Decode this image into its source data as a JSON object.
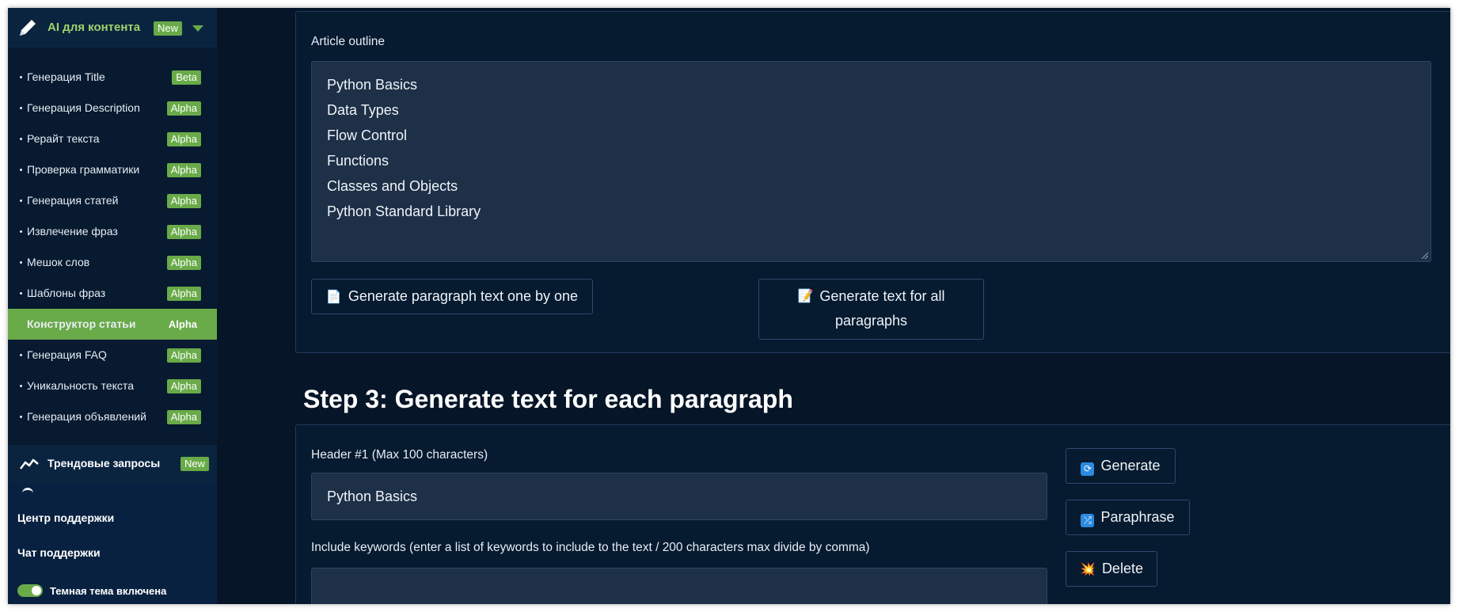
{
  "sidebar": {
    "header": {
      "title": "AI для контента",
      "badge": "New"
    },
    "items": [
      {
        "label": "Генерация Title",
        "badge": "Beta"
      },
      {
        "label": "Генерация Description",
        "badge": "Alpha"
      },
      {
        "label": "Рерайт текста",
        "badge": "Alpha"
      },
      {
        "label": "Проверка грамматики",
        "badge": "Alpha"
      },
      {
        "label": "Генерация статей",
        "badge": "Alpha"
      },
      {
        "label": "Извлечение фраз",
        "badge": "Alpha"
      },
      {
        "label": "Мешок слов",
        "badge": "Alpha"
      },
      {
        "label": "Шаблоны фраз",
        "badge": "Alpha"
      },
      {
        "label": "Конструктор статьи",
        "badge": "Alpha",
        "active": true
      },
      {
        "label": "Генерация FAQ",
        "badge": "Alpha"
      },
      {
        "label": "Уникальность текста",
        "badge": "Alpha"
      },
      {
        "label": "Генерация объявлений",
        "badge": "Alpha"
      }
    ],
    "trend": {
      "title": "Трендовые запросы",
      "badge": "New"
    },
    "support_center": "Центр поддержки",
    "support_chat": "Чат поддержки",
    "dark_theme": {
      "label": "Темная тема включена",
      "enabled": true
    }
  },
  "outline": {
    "label": "Article outline",
    "lines": [
      "Python Basics",
      "Data Types",
      "Flow Control",
      "Functions",
      "Classes and Objects",
      "Python Standard Library"
    ],
    "btn_one_by_one": "Generate paragraph text one by one",
    "btn_all_line1": "Generate text for all",
    "btn_all_line2": "paragraphs"
  },
  "step3": {
    "heading": "Step 3: Generate text for each paragraph",
    "header_label": "Header #1 (Max 100 characters)",
    "header_value": "Python Basics",
    "keywords_label": "Include keywords (enter a list of keywords to include to the text / 200 characters max divide by comma)",
    "keywords_value": "",
    "btn_generate": "Generate",
    "btn_paraphrase": "Paraphrase",
    "btn_delete": "Delete"
  },
  "colors": {
    "accent": "#69aa49",
    "background": "#061628",
    "field": "#1d3048"
  }
}
